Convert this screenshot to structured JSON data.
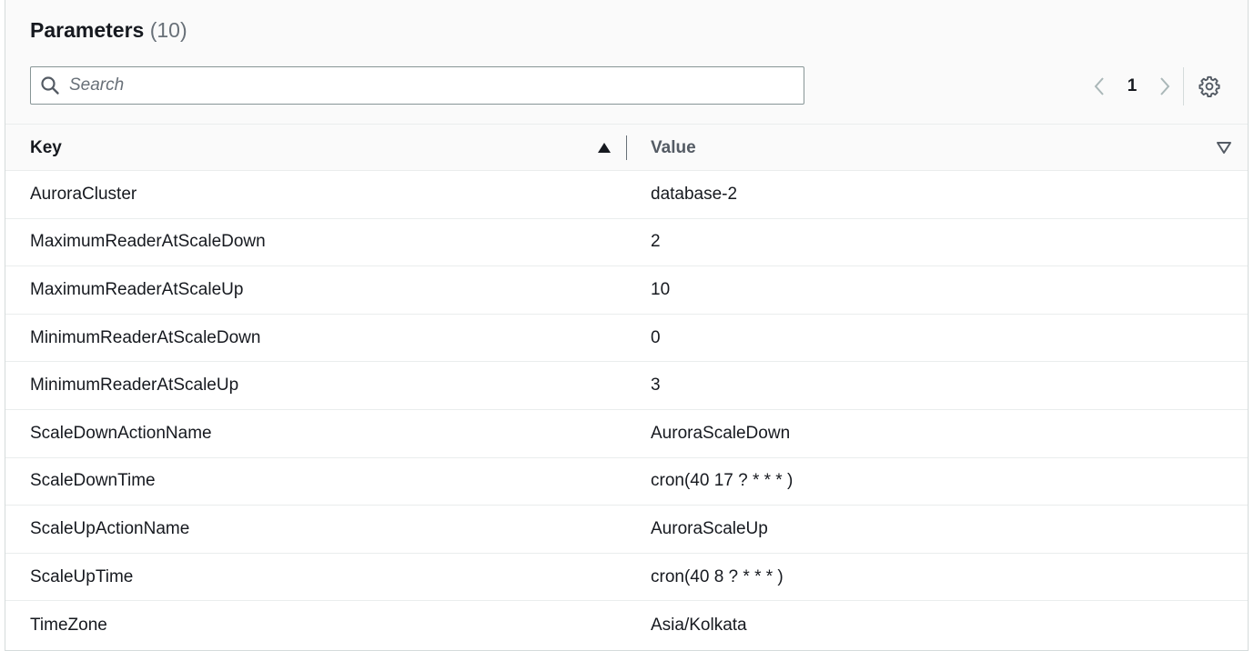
{
  "header": {
    "title": "Parameters",
    "count": "(10)"
  },
  "search": {
    "placeholder": "Search",
    "value": ""
  },
  "pagination": {
    "current_page": "1"
  },
  "table": {
    "columns": {
      "key": "Key",
      "value": "Value"
    },
    "rows": [
      {
        "key": "AuroraCluster",
        "value": "database-2"
      },
      {
        "key": "MaximumReaderAtScaleDown",
        "value": "2"
      },
      {
        "key": "MaximumReaderAtScaleUp",
        "value": "10"
      },
      {
        "key": "MinimumReaderAtScaleDown",
        "value": "0"
      },
      {
        "key": "MinimumReaderAtScaleUp",
        "value": "3"
      },
      {
        "key": "ScaleDownActionName",
        "value": "AuroraScaleDown"
      },
      {
        "key": "ScaleDownTime",
        "value": "cron(40 17 ? * * * )"
      },
      {
        "key": "ScaleUpActionName",
        "value": "AuroraScaleUp"
      },
      {
        "key": "ScaleUpTime",
        "value": "cron(40 8 ? * * * )"
      },
      {
        "key": "TimeZone",
        "value": "Asia/Kolkata"
      }
    ]
  },
  "icons": {
    "search": "search-icon",
    "prev": "chevron-left-icon",
    "next": "chevron-right-icon",
    "settings": "gear-icon",
    "sort_asc": "sort-ascending-icon",
    "sort_none": "sort-descending-icon"
  },
  "colors": {
    "text": "#16191f",
    "muted": "#687078",
    "border": "#879596"
  }
}
